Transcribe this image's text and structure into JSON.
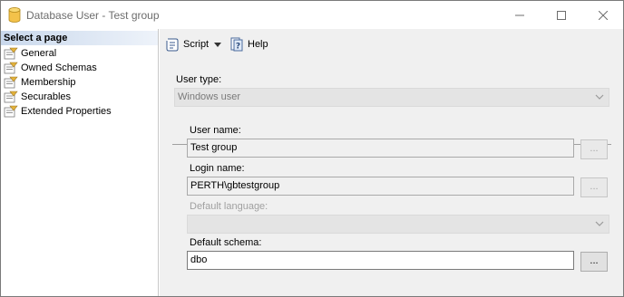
{
  "window": {
    "title": "Database User - Test group",
    "controls": {
      "minimize_icon": "minimize-icon",
      "maximize_icon": "maximize-icon",
      "close_icon": "close-icon"
    }
  },
  "left_pane": {
    "header": "Select a page",
    "items": [
      {
        "label": "General",
        "icon": "page-icon"
      },
      {
        "label": "Owned Schemas",
        "icon": "page-icon"
      },
      {
        "label": "Membership",
        "icon": "page-icon"
      },
      {
        "label": "Securables",
        "icon": "page-icon"
      },
      {
        "label": "Extended Properties",
        "icon": "page-icon"
      }
    ]
  },
  "toolbar": {
    "script_label": "Script",
    "help_label": "Help"
  },
  "form": {
    "user_type_label": "User type:",
    "user_type_value": "Windows user",
    "user_name_label": "User name:",
    "user_name_value": "Test group",
    "login_name_label": "Login name:",
    "login_name_value": "PERTH\\gbtestgroup",
    "default_language_label": "Default language:",
    "default_language_value": "",
    "default_schema_label": "Default schema:",
    "default_schema_value": "dbo",
    "browse_label": "..."
  },
  "colors": {
    "header_gradient_start": "#c9d8ec",
    "panel_background": "#f0f0f0",
    "disabled_text": "#a0a0a0"
  }
}
